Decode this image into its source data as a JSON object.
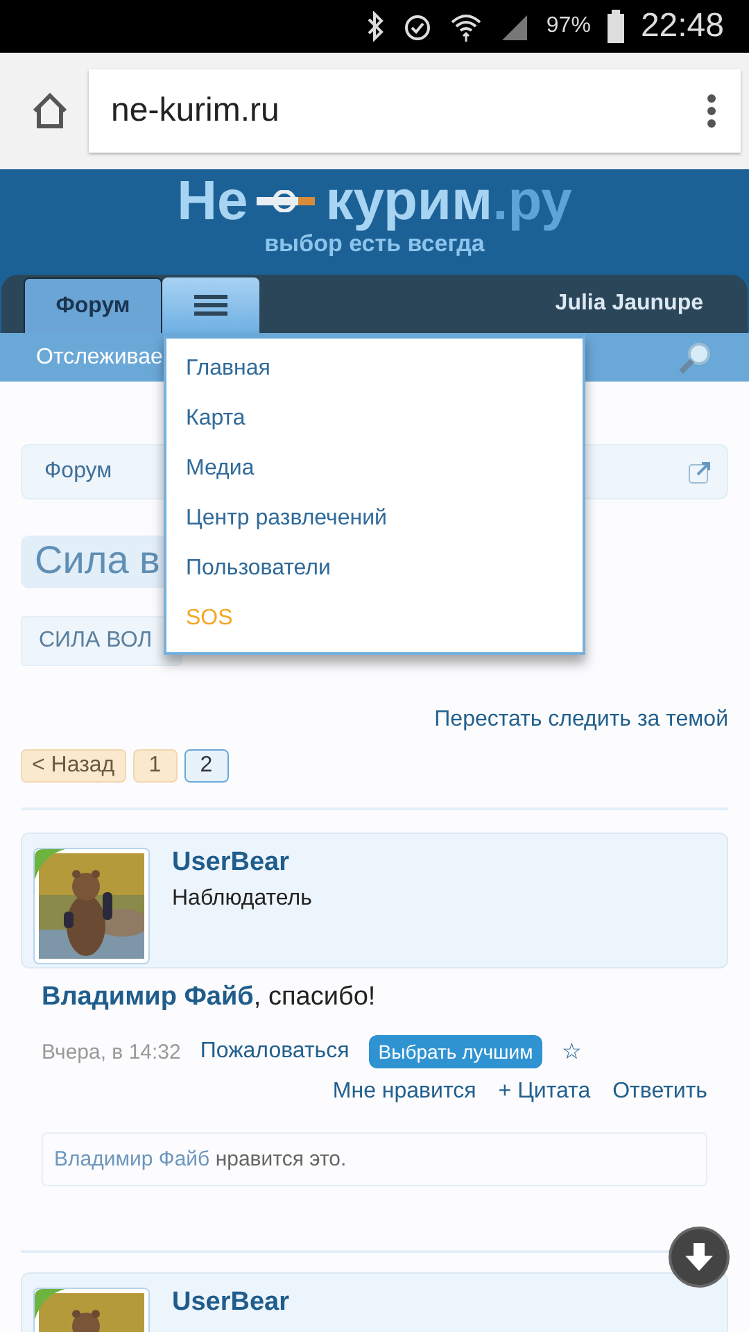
{
  "status_bar": {
    "battery": "97%",
    "time": "22:48"
  },
  "browser": {
    "url": "ne-kurim.ru"
  },
  "logo": {
    "word_1": "Не",
    "word_2": "курим",
    "suffix": ".ру",
    "tagline": "выбор есть всегда"
  },
  "nav": {
    "tabs": [
      {
        "label": "Форум",
        "selected": true
      }
    ],
    "menu_expanded": true,
    "user": "Julia Jaunupe",
    "subnav_link": "Отслеживае"
  },
  "menu": {
    "items": [
      {
        "label": "Главная",
        "color": "#2f6a9a"
      },
      {
        "label": "Карта",
        "color": "#2f6a9a"
      },
      {
        "label": "Медиа",
        "color": "#2f6a9a"
      },
      {
        "label": "Центр развлечений",
        "color": "#2f6a9a"
      },
      {
        "label": "Пользователи",
        "color": "#2f6a9a"
      },
      {
        "label": "SOS",
        "color": "#f5a623"
      }
    ]
  },
  "breadcrumb": [
    "Форум"
  ],
  "thread": {
    "title": "Сила в",
    "tag": "СИЛА ВОЛ",
    "unwatch": "Перестать следить за темой"
  },
  "pagination": {
    "prev": "< Назад",
    "pages": [
      {
        "label": "1",
        "selected": false
      },
      {
        "label": "2",
        "selected": true
      }
    ]
  },
  "posts": [
    {
      "user": "UserBear",
      "role": "Наблюдатель",
      "online": true,
      "message": "**Владимир Файб**, спасибо!",
      "date": "Вчера, в 14:32",
      "report": "Пожаловаться",
      "best": "Выбрать лучшим",
      "star": "☆",
      "actions": [
        "Мне нравится",
        "+ Цитата",
        "Ответить"
      ],
      "likes": {
        "name": "Владимир Файб",
        "text": " нравится это."
      }
    },
    {
      "user": "UserBear",
      "online": true
    }
  ]
}
